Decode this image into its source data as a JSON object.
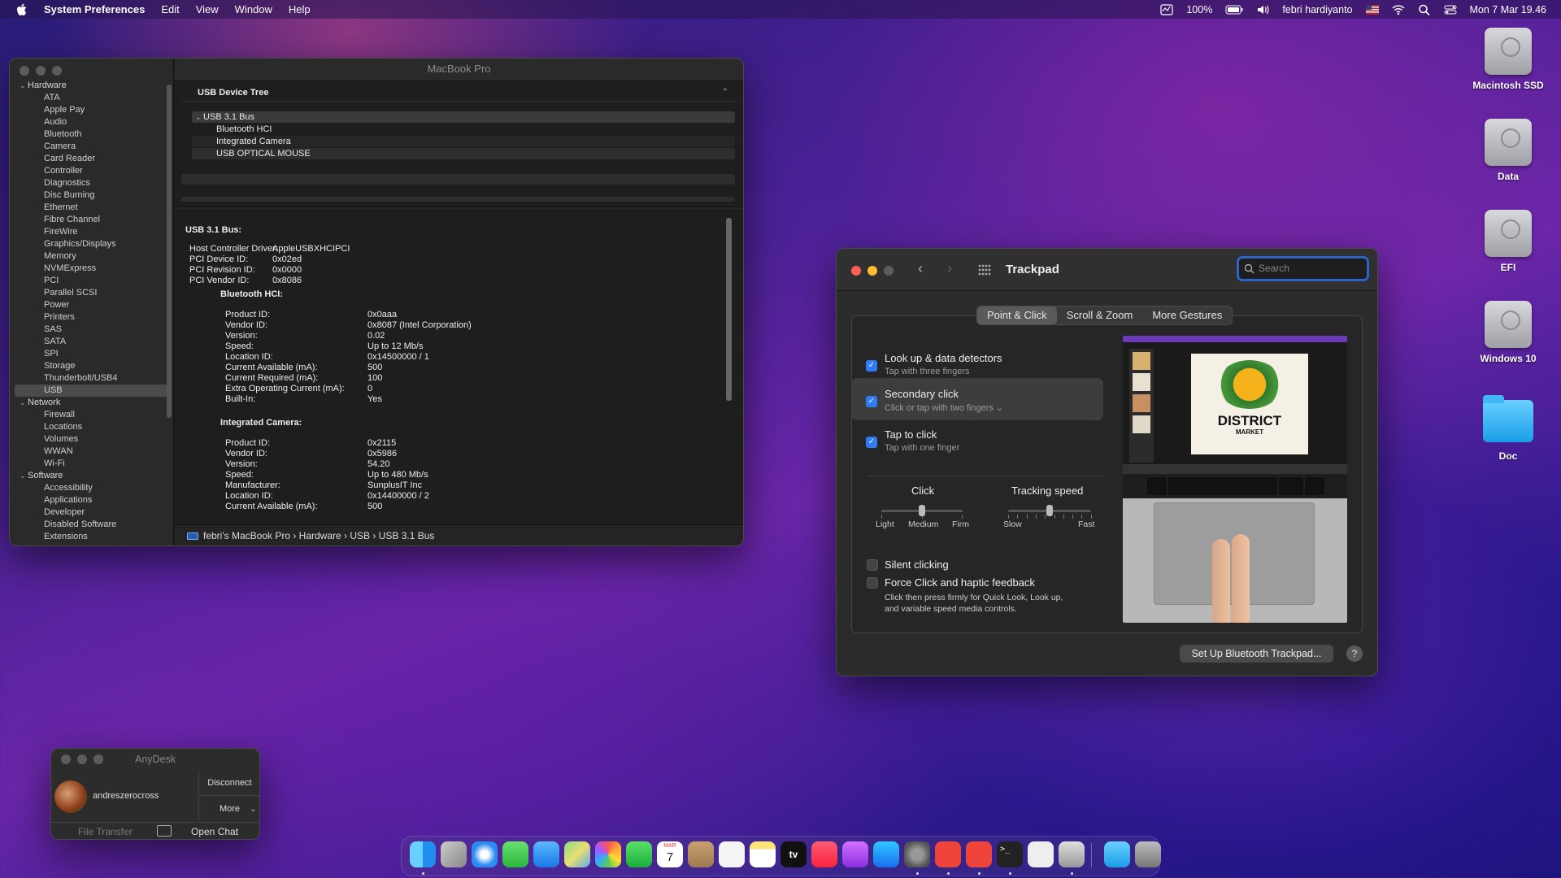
{
  "menubar": {
    "app": "System Preferences",
    "menus": [
      "Edit",
      "View",
      "Window",
      "Help"
    ],
    "battery": "100%",
    "user": "febri hardiyanto",
    "datetime": "Mon 7 Mar  19.46"
  },
  "sysinfo": {
    "title": "MacBook Pro",
    "sidebar": [
      {
        "label": "Hardware",
        "group": true
      },
      {
        "label": "ATA"
      },
      {
        "label": "Apple Pay"
      },
      {
        "label": "Audio"
      },
      {
        "label": "Bluetooth"
      },
      {
        "label": "Camera"
      },
      {
        "label": "Card Reader"
      },
      {
        "label": "Controller"
      },
      {
        "label": "Diagnostics"
      },
      {
        "label": "Disc Burning"
      },
      {
        "label": "Ethernet"
      },
      {
        "label": "Fibre Channel"
      },
      {
        "label": "FireWire"
      },
      {
        "label": "Graphics/Displays"
      },
      {
        "label": "Memory"
      },
      {
        "label": "NVMExpress"
      },
      {
        "label": "PCI"
      },
      {
        "label": "Parallel SCSI"
      },
      {
        "label": "Power"
      },
      {
        "label": "Printers"
      },
      {
        "label": "SAS"
      },
      {
        "label": "SATA"
      },
      {
        "label": "SPI"
      },
      {
        "label": "Storage"
      },
      {
        "label": "Thunderbolt/USB4"
      },
      {
        "label": "USB",
        "selected": true
      },
      {
        "label": "Network",
        "group": true
      },
      {
        "label": "Firewall"
      },
      {
        "label": "Locations"
      },
      {
        "label": "Volumes"
      },
      {
        "label": "WWAN"
      },
      {
        "label": "Wi-Fi"
      },
      {
        "label": "Software",
        "group": true
      },
      {
        "label": "Accessibility"
      },
      {
        "label": "Applications"
      },
      {
        "label": "Developer"
      },
      {
        "label": "Disabled Software"
      },
      {
        "label": "Extensions"
      }
    ],
    "tree_header": "USB Device Tree",
    "tree": {
      "bus": "USB 3.1 Bus",
      "devices": [
        "Bluetooth HCI",
        "Integrated Camera",
        "USB OPTICAL MOUSE"
      ]
    },
    "detail": {
      "heading": "USB 3.1 Bus:",
      "bus_props": [
        [
          "Host Controller Driver:",
          "AppleUSBXHCIPCI"
        ],
        [
          "PCI Device ID:",
          "0x02ed"
        ],
        [
          "PCI Revision ID:",
          "0x0000"
        ],
        [
          "PCI Vendor ID:",
          "0x8086"
        ]
      ],
      "bt_heading": "Bluetooth HCI:",
      "bt_props": [
        [
          "Product ID:",
          "0x0aaa"
        ],
        [
          "Vendor ID:",
          "0x8087  (Intel Corporation)"
        ],
        [
          "Version:",
          "0.02"
        ],
        [
          "Speed:",
          "Up to 12 Mb/s"
        ],
        [
          "Location ID:",
          "0x14500000 / 1"
        ],
        [
          "Current Available (mA):",
          "500"
        ],
        [
          "Current Required (mA):",
          "100"
        ],
        [
          "Extra Operating Current (mA):",
          "0"
        ],
        [
          "Built-In:",
          "Yes"
        ]
      ],
      "cam_heading": "Integrated Camera:",
      "cam_props": [
        [
          "Product ID:",
          "0x2115"
        ],
        [
          "Vendor ID:",
          "0x5986"
        ],
        [
          "Version:",
          "54.20"
        ],
        [
          "Speed:",
          "Up to 480 Mb/s"
        ],
        [
          "Manufacturer:",
          "SunplusIT Inc"
        ],
        [
          "Location ID:",
          "0x14400000 / 2"
        ],
        [
          "Current Available (mA):",
          "500"
        ]
      ]
    },
    "path": "febri's MacBook Pro  ›  Hardware  ›  USB  ›  USB 3.1 Bus"
  },
  "trackpad": {
    "title": "Trackpad",
    "search_placeholder": "Search",
    "tabs": [
      "Point & Click",
      "Scroll & Zoom",
      "More Gestures"
    ],
    "options": [
      {
        "title": "Look up & data detectors",
        "sub": "Tap with three fingers",
        "checked": true
      },
      {
        "title": "Secondary click",
        "sub": "Click or tap with two fingers ⌄",
        "checked": true
      },
      {
        "title": "Tap to click",
        "sub": "Tap with one finger",
        "checked": true
      }
    ],
    "click": {
      "title": "Click",
      "labels": [
        "Light",
        "Medium",
        "Firm"
      ],
      "value": 0.5
    },
    "tracking": {
      "title": "Tracking speed",
      "labels": [
        "Slow",
        "Fast"
      ],
      "value": 0.5
    },
    "silent": "Silent clicking",
    "force": "Force Click and haptic feedback",
    "force_desc1": "Click then press firmly for Quick Look, Look up,",
    "force_desc2": "and variable speed media controls.",
    "video_text1": "DISTRICT",
    "video_text2": "MARKET",
    "setup_button": "Set Up Bluetooth Trackpad...",
    "help": "?"
  },
  "anydesk": {
    "title": "AnyDesk",
    "user": "andreszerocross",
    "disconnect": "Disconnect",
    "more": "More",
    "file_transfer": "File Transfer",
    "open_chat": "Open Chat"
  },
  "desktop": [
    "Macintosh SSD",
    "Data",
    "EFI",
    "Windows 10",
    "Doc"
  ],
  "dock_calendar": {
    "month": "MAR",
    "day": "7"
  },
  "dock_tv": "tv"
}
